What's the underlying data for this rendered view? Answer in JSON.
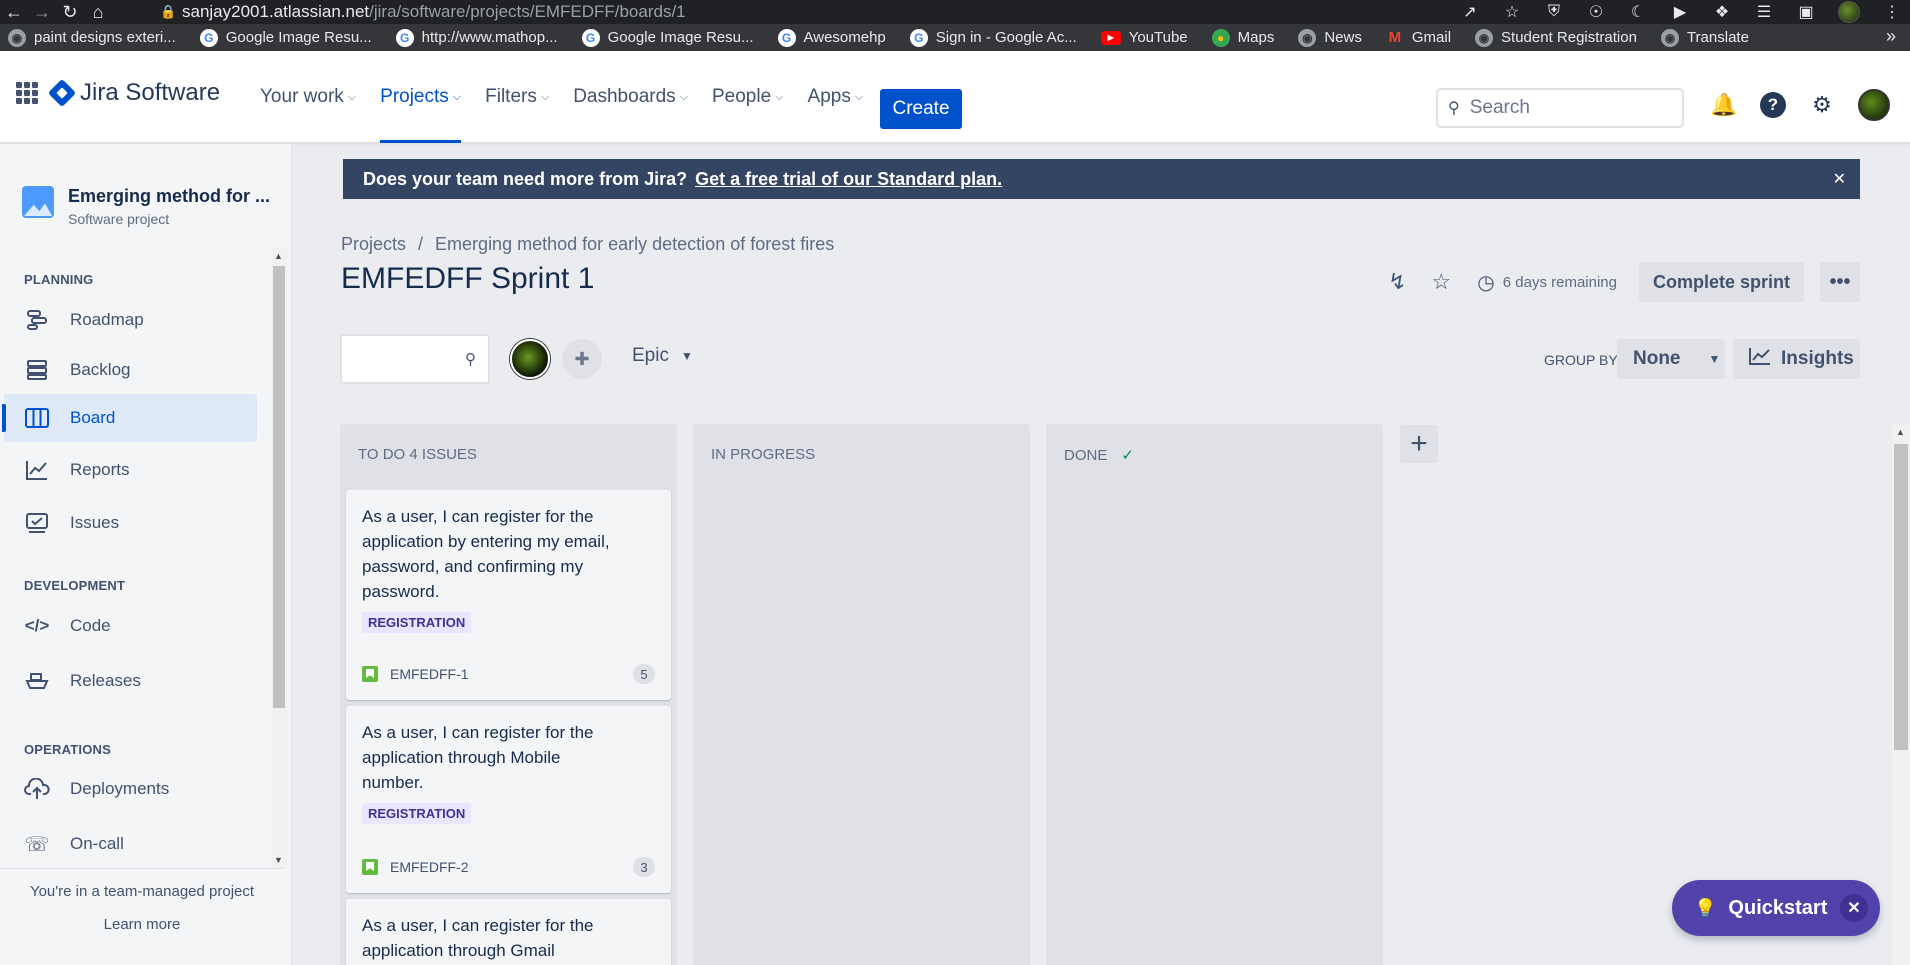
{
  "browser": {
    "url_host": "sanjay2001.atlassian.net",
    "url_path": "/jira/software/projects/EMFEDFF/boards/1",
    "bookmarks": [
      {
        "icon": "globe",
        "label": "paint designs exteri..."
      },
      {
        "icon": "google",
        "label": "Google Image Resu..."
      },
      {
        "icon": "google",
        "label": "http://www.mathop..."
      },
      {
        "icon": "google",
        "label": "Google Image Resu..."
      },
      {
        "icon": "google",
        "label": "Awesomehp"
      },
      {
        "icon": "google",
        "label": "Sign in - Google Ac..."
      },
      {
        "icon": "youtube",
        "label": "YouTube"
      },
      {
        "icon": "maps",
        "label": "Maps"
      },
      {
        "icon": "globe",
        "label": "News"
      },
      {
        "icon": "gmail",
        "label": "Gmail"
      },
      {
        "icon": "globe",
        "label": "Student Registration"
      },
      {
        "icon": "globe",
        "label": "Translate"
      }
    ]
  },
  "topnav": {
    "product": "Jira Software",
    "menu": [
      "Your work",
      "Projects",
      "Filters",
      "Dashboards",
      "People",
      "Apps"
    ],
    "active_menu": "Projects",
    "create_label": "Create",
    "search_placeholder": "Search"
  },
  "sidebar": {
    "project_name": "Emerging method for ...",
    "project_type": "Software project",
    "sections": {
      "planning": "PLANNING",
      "development": "DEVELOPMENT",
      "operations": "OPERATIONS"
    },
    "items": {
      "roadmap": "Roadmap",
      "backlog": "Backlog",
      "board": "Board",
      "reports": "Reports",
      "issues": "Issues",
      "code": "Code",
      "releases": "Releases",
      "deployments": "Deployments",
      "oncall": "On-call"
    },
    "active_item": "Board",
    "footer_text": "You're in a team-managed project",
    "footer_link": "Learn more"
  },
  "banner": {
    "text": "Does your team need more from Jira?",
    "link": "Get a free trial of our Standard plan."
  },
  "breadcrumb": [
    "Projects",
    "Emerging method for early detection of forest fires"
  ],
  "board": {
    "title": "EMFEDFF Sprint 1",
    "remaining": "6 days remaining",
    "complete_label": "Complete sprint",
    "epic_label": "Epic",
    "group_by_label": "GROUP BY",
    "group_by_value": "None",
    "insights_label": "Insights",
    "columns": {
      "todo": "TO DO 4 ISSUES",
      "inprogress": "IN PROGRESS",
      "done": "DONE"
    },
    "cards": [
      {
        "summary": "As a user, I can register for the application by entering my email, password, and confirming my password.",
        "tag": "REGISTRATION",
        "key": "EMFEDFF-1",
        "points": "5"
      },
      {
        "summary": "As a user, I can register for the application through Mobile number.",
        "tag": "REGISTRATION",
        "key": "EMFEDFF-2",
        "points": "3"
      },
      {
        "summary": "As a user, I can register for the application through Gmail",
        "tag": "",
        "key": "",
        "points": ""
      }
    ]
  },
  "quickstart_label": "Quickstart",
  "colors": {
    "brand": "#0052cc",
    "banner": "#344563",
    "tag_bg": "#eae6ff",
    "tag_text": "#403294",
    "quickstart": "#5243aa",
    "story": "#63ba3c"
  }
}
